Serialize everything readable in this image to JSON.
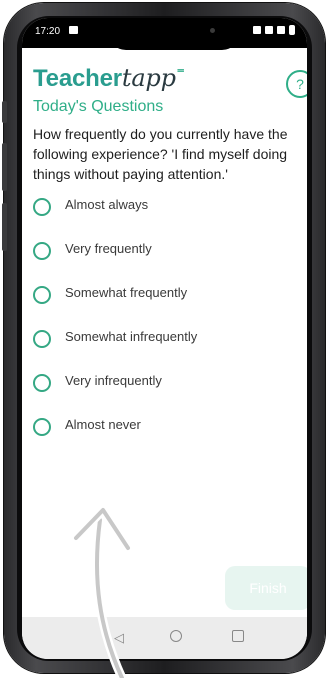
{
  "status_bar": {
    "time": "17:20"
  },
  "app": {
    "logo_teacher": "Teacher",
    "logo_tapp": "tapp",
    "logo_spark": "⁼",
    "help_label": "?",
    "subtitle": "Today's Questions",
    "question": "How frequently do you currently have the following experience? 'I find myself doing things without paying attention.'",
    "options": [
      {
        "label": "Almost always"
      },
      {
        "label": "Very frequently"
      },
      {
        "label": "Somewhat frequently"
      },
      {
        "label": "Somewhat infrequently"
      },
      {
        "label": "Very infrequently"
      },
      {
        "label": "Almost never"
      }
    ],
    "finish_label": "Finish"
  },
  "nav_bar": {
    "back_icon": "◁",
    "home_icon": "circle",
    "recent_icon": "square"
  },
  "colors": {
    "accent": "#2fae88",
    "brand": "#2a9d8f",
    "finish_bg": "#e7f5f0"
  }
}
